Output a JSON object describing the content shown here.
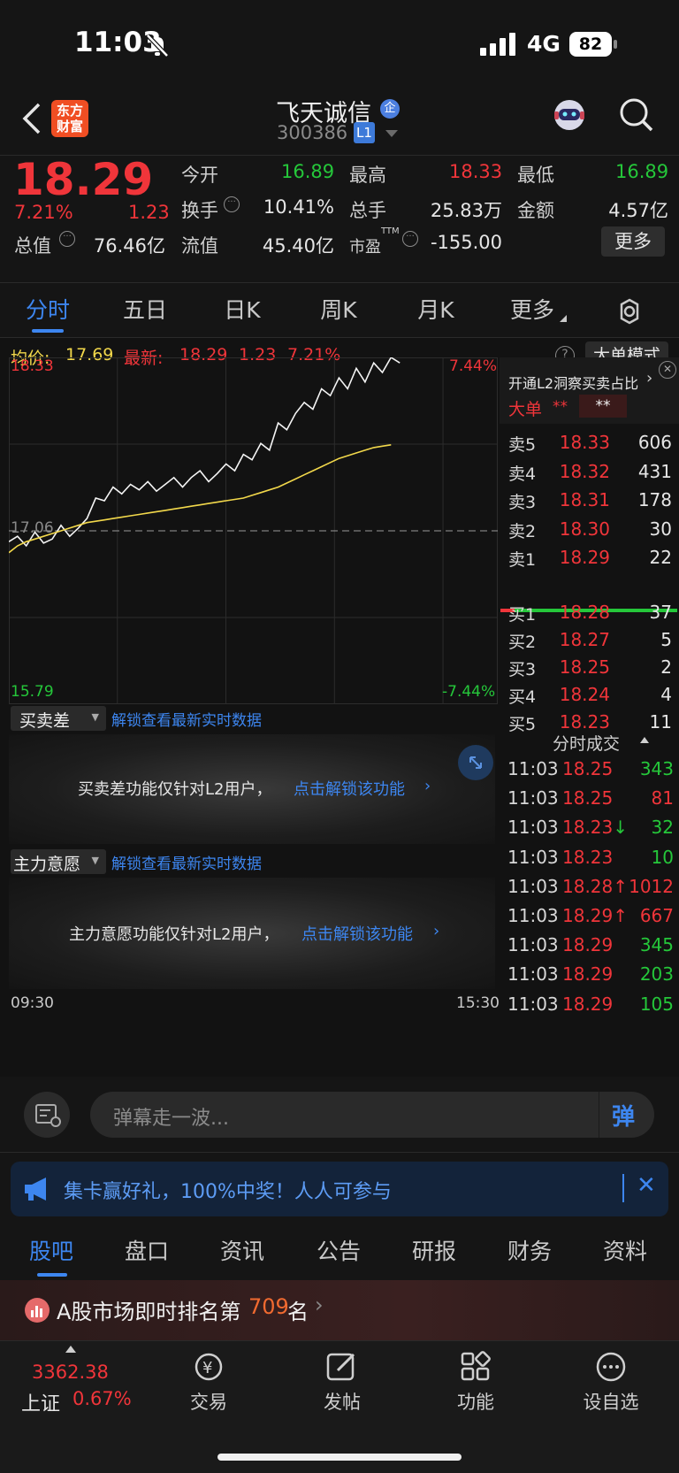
{
  "status_bar": {
    "time": "11:03",
    "network": "4G",
    "battery": "82"
  },
  "header": {
    "logo_text": "东方财富",
    "stock_name": "飞天诚信",
    "enterprise_badge": "企",
    "stock_code": "300386",
    "level_badge": "L1"
  },
  "quote": {
    "price": "18.29",
    "change_pct": "7.21%",
    "change_amt": "1.23",
    "open_label": "今开",
    "open": "16.89",
    "high_label": "最高",
    "high": "18.33",
    "low_label": "最低",
    "low": "16.89",
    "turnover_label": "换手",
    "turnover": "10.41%",
    "volume_label": "总手",
    "volume": "25.83万",
    "amount_label": "金额",
    "amount": "4.57亿",
    "mcap_label": "总值",
    "mcap": "76.46亿",
    "float_label": "流值",
    "float": "45.40亿",
    "pe_label": "市盈",
    "pe_sup": "TTM",
    "pe": "-155.00",
    "more_button": "更多"
  },
  "tabs": [
    "分时",
    "五日",
    "日K",
    "周K",
    "月K",
    "更多"
  ],
  "chart_info": {
    "avg_label": "均价:",
    "avg": "17.69",
    "latest_label": "最新:",
    "latest": "18.29",
    "latest_chg": "1.23",
    "latest_pct": "7.21%",
    "big_order_button": "大单模式"
  },
  "chart_data": {
    "type": "line",
    "y_top": "18.33",
    "y_mid": "17.06",
    "y_bottom": "15.79",
    "pct_top": "7.44%",
    "pct_bottom": "-7.44%",
    "x_start": "09:30",
    "x_end": "15:30",
    "ylim": [
      15.79,
      18.33
    ],
    "series": [
      {
        "values": [
          16.98,
          17.02,
          16.95,
          17.05,
          16.97,
          17.0,
          17.1,
          17.02,
          17.08,
          17.15,
          17.3,
          17.28,
          17.38,
          17.33,
          17.4,
          17.36,
          17.42,
          17.35,
          17.4,
          17.45,
          17.38,
          17.45,
          17.5,
          17.42,
          17.48,
          17.55,
          17.5,
          17.62,
          17.58,
          17.7,
          17.65,
          17.85,
          17.8,
          17.92,
          18.0,
          17.95,
          18.1,
          18.05,
          18.18,
          18.1,
          18.25,
          18.15,
          18.29,
          18.22,
          18.33,
          18.29
        ]
      },
      {
        "values": [
          16.9,
          16.95,
          16.98,
          17.0,
          17.02,
          17.04,
          17.06,
          17.08,
          17.1,
          17.12,
          17.13,
          17.14,
          17.15,
          17.16,
          17.17,
          17.18,
          17.19,
          17.2,
          17.21,
          17.22,
          17.23,
          17.24,
          17.25,
          17.26,
          17.27,
          17.28,
          17.29,
          17.3,
          17.32,
          17.34,
          17.36,
          17.38,
          17.41,
          17.44,
          17.47,
          17.5,
          17.53,
          17.56,
          17.59,
          17.61,
          17.63,
          17.65,
          17.67,
          17.68,
          17.69
        ]
      }
    ]
  },
  "indicators": [
    {
      "name": "买卖差",
      "unlock_link": "解锁查看最新实时数据",
      "notice": "买卖差功能仅针对L2用户，",
      "notice_link": "点击解锁该功能"
    },
    {
      "name": "主力意愿",
      "unlock_link": "解锁查看最新实时数据",
      "notice": "主力意愿功能仅针对L2用户，",
      "notice_link": "点击解锁该功能"
    }
  ],
  "order_book": {
    "promo": "开通L2洞察买卖占比",
    "big_order_label": "大单",
    "masked1": "**",
    "masked2": "**",
    "asks": [
      {
        "label": "卖5",
        "price": "18.33",
        "vol": "606"
      },
      {
        "label": "卖4",
        "price": "18.32",
        "vol": "431"
      },
      {
        "label": "卖3",
        "price": "18.31",
        "vol": "178"
      },
      {
        "label": "卖2",
        "price": "18.30",
        "vol": "30"
      },
      {
        "label": "卖1",
        "price": "18.29",
        "vol": "22"
      }
    ],
    "bids": [
      {
        "label": "买1",
        "price": "18.28",
        "vol": "37"
      },
      {
        "label": "买2",
        "price": "18.27",
        "vol": "5"
      },
      {
        "label": "买3",
        "price": "18.25",
        "vol": "2"
      },
      {
        "label": "买4",
        "price": "18.24",
        "vol": "4"
      },
      {
        "label": "买5",
        "price": "18.23",
        "vol": "11"
      }
    ]
  },
  "trades": {
    "title": "分时成交",
    "rows": [
      {
        "time": "11:03",
        "price": "18.25",
        "arrow": "",
        "vol": "343",
        "color": "#25c73a"
      },
      {
        "time": "11:03",
        "price": "18.25",
        "arrow": "",
        "vol": "81",
        "color": "#f0353a"
      },
      {
        "time": "11:03",
        "price": "18.23",
        "arrow": "↓",
        "vol": "32",
        "color": "#25c73a"
      },
      {
        "time": "11:03",
        "price": "18.23",
        "arrow": "",
        "vol": "10",
        "color": "#25c73a"
      },
      {
        "time": "11:03",
        "price": "18.28",
        "arrow": "↑",
        "vol": "1012",
        "color": "#f0353a"
      },
      {
        "time": "11:03",
        "price": "18.29",
        "arrow": "↑",
        "vol": "667",
        "color": "#f0353a"
      },
      {
        "time": "11:03",
        "price": "18.29",
        "arrow": "",
        "vol": "345",
        "color": "#25c73a"
      },
      {
        "time": "11:03",
        "price": "18.29",
        "arrow": "",
        "vol": "203",
        "color": "#25c73a"
      },
      {
        "time": "11:03",
        "price": "18.29",
        "arrow": "",
        "vol": "105",
        "color": "#25c73a"
      }
    ]
  },
  "danmu": {
    "placeholder": "弹幕走一波...",
    "send_label": "弹"
  },
  "banner": {
    "text": "集卡赢好礼，100%中奖！人人可参与"
  },
  "bottom_tabs": [
    "股吧",
    "盘口",
    "资讯",
    "公告",
    "研报",
    "财务",
    "资料"
  ],
  "ranking": {
    "prefix": "A股市场即时排名第",
    "rank": "709",
    "suffix": "名"
  },
  "index": {
    "value": "3362.38",
    "name": "上证",
    "pct": "0.67%"
  },
  "bottom_nav": [
    "交易",
    "发帖",
    "功能",
    "设自选"
  ]
}
